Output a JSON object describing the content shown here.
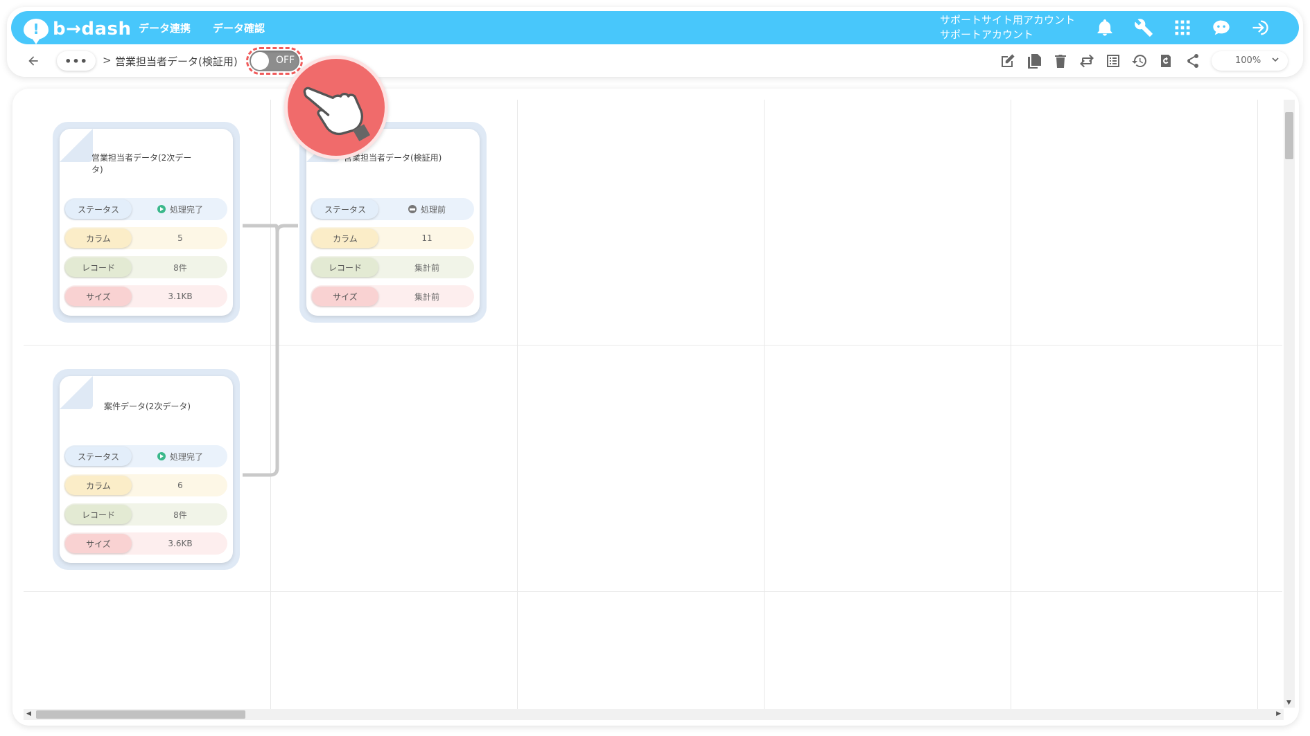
{
  "app": {
    "logo_mark": "!",
    "logo_text": "b→dash"
  },
  "nav": {
    "items": [
      "データ連携",
      "データ確認"
    ]
  },
  "account": {
    "line1": "サポートサイト用アカウント",
    "line2": "サポートアカウント"
  },
  "header_icons": [
    "bell-icon",
    "wrench-icon",
    "apps-grid-icon",
    "chat-bot-icon",
    "logout-icon"
  ],
  "breadcrumb": {
    "more": "•••",
    "separator": ">",
    "title": "営業担当者データ(検証用)"
  },
  "toggle": {
    "label": "OFF",
    "state": "off"
  },
  "toolbar_icons": [
    "edit-icon",
    "copy-icon",
    "delete-icon",
    "swap-icon",
    "list-icon",
    "history-icon",
    "refresh-icon",
    "share-icon"
  ],
  "zoom": {
    "value": "100%"
  },
  "cards": [
    {
      "title": "営業担当者データ(2次データ)",
      "status_label": "ステータス",
      "status_value": "処理完了",
      "column_label": "カラム",
      "column_value": "5",
      "record_label": "レコード",
      "record_value": "8件",
      "size_label": "サイズ",
      "size_value": "3.1KB"
    },
    {
      "title": "営業担当者データ(検証用)",
      "status_label": "ステータス",
      "status_value": "処理前",
      "column_label": "カラム",
      "column_value": "11",
      "record_label": "レコード",
      "record_value": "集計前",
      "size_label": "サイズ",
      "size_value": "集計前"
    },
    {
      "title": "案件データ(2次データ)",
      "status_label": "ステータス",
      "status_value": "処理完了",
      "column_label": "カラム",
      "column_value": "6",
      "record_label": "レコード",
      "record_value": "8件",
      "size_label": "サイズ",
      "size_value": "3.6KB"
    }
  ],
  "colors": {
    "header": "#48c7fb",
    "accent_red": "#f06b6b",
    "status_done": "#3bb88b"
  }
}
